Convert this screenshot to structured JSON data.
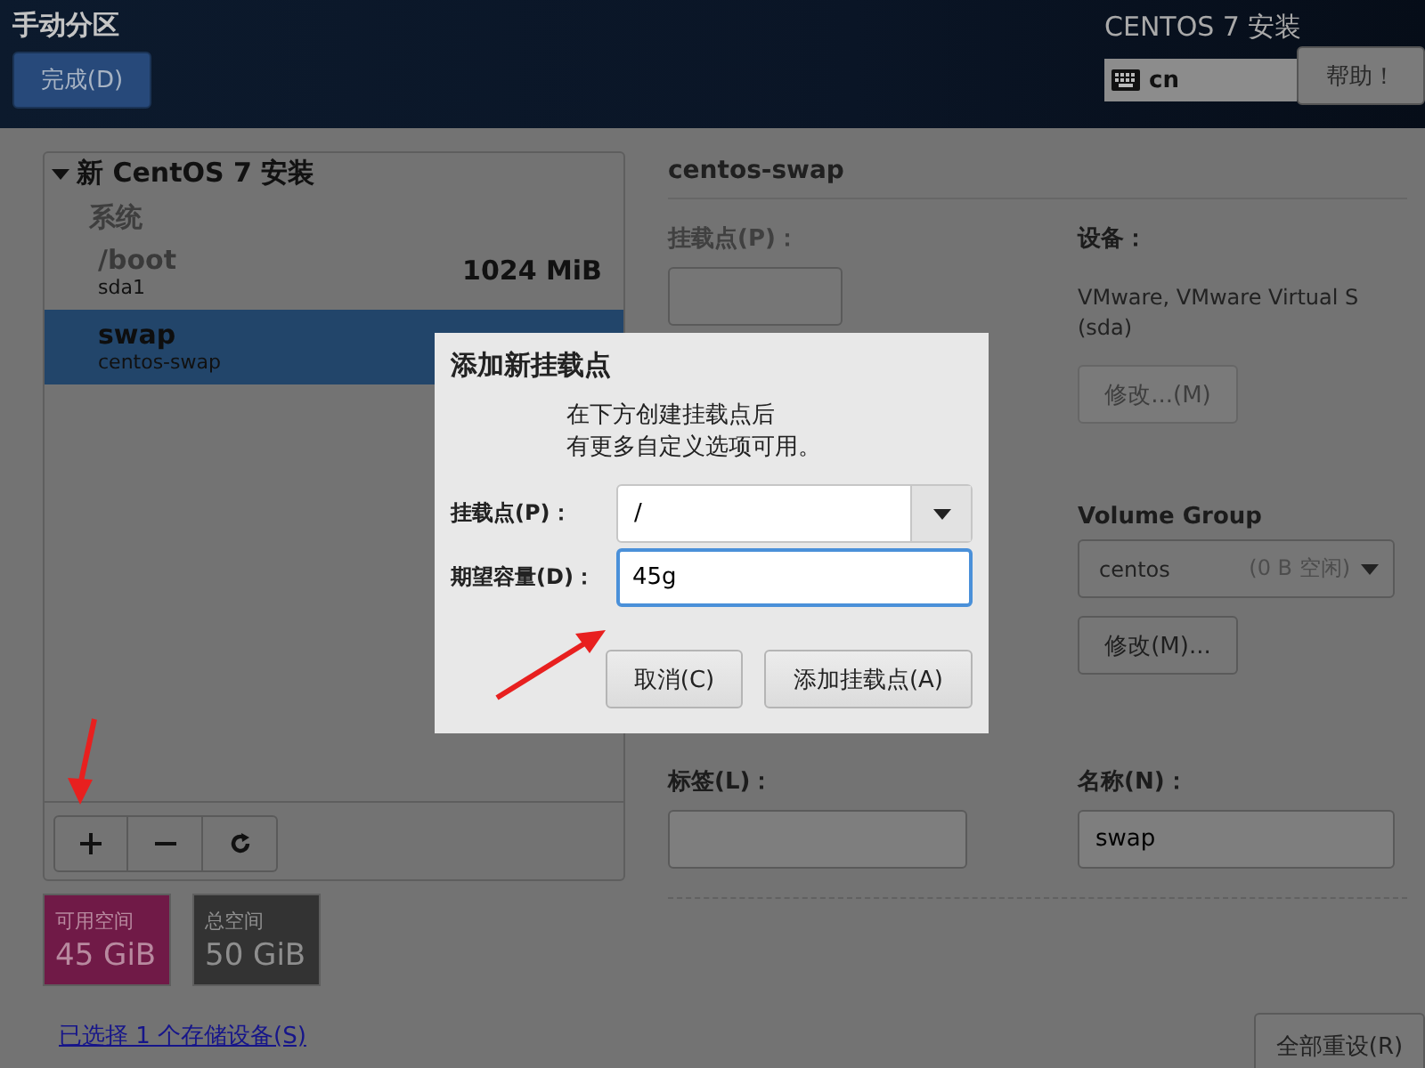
{
  "header": {
    "title": "手动分区",
    "done_button": "完成(D)",
    "product": "CENTOS 7 安装",
    "keyboard_layout": "cn",
    "help_button": "帮助！"
  },
  "partition_tree": {
    "heading": "新 CentOS 7 安装",
    "expanded": true,
    "group": "系统",
    "items": [
      {
        "name": "/boot",
        "device": "sda1",
        "size": "1024 MiB",
        "selected": false
      },
      {
        "name": "swap",
        "device": "centos-swap",
        "selected": true
      }
    ]
  },
  "toolbar": [
    {
      "kind": "add"
    },
    {
      "kind": "remove"
    },
    {
      "kind": "refresh"
    }
  ],
  "space": [
    {
      "kind": "available",
      "label": "可用空间",
      "value": "45 GiB"
    },
    {
      "kind": "total",
      "label": "总空间",
      "value": "50 GiB"
    }
  ],
  "storage_link": "已选择 1 个存储设备(S)",
  "details": {
    "title": "centos-swap",
    "mount_point": {
      "label": "挂载点(P)：",
      "disabled": true
    },
    "device_label": "设备：",
    "device_lines": [
      "VMware, VMware Virtual S",
      "(sda)"
    ],
    "modify_button": {
      "label": "修改...(M)",
      "disabled": true
    },
    "volume_group_label": "Volume Group",
    "volume_group": {
      "name": "centos",
      "free": "(0 B 空闲)"
    },
    "vg_modify_button": {
      "label": "修改(M)...",
      "disabled": false
    },
    "label_field": {
      "label": "标签(L)："
    },
    "name_field": {
      "label": "名称(N)：",
      "value": "swap"
    }
  },
  "reset_button": "全部重设(R)",
  "dialog": {
    "title": "添加新挂载点",
    "message_lines": [
      "在下方创建挂载点后",
      "有更多自定义选项可用。"
    ],
    "fields": [
      {
        "kind": "combo",
        "label": "挂载点(P)：",
        "value": "/",
        "focused": false
      },
      {
        "kind": "entry",
        "label": "期望容量(D)：",
        "value": "45g",
        "focused": true
      }
    ],
    "buttons": [
      "取消(C)",
      "添加挂载点(A)"
    ]
  }
}
